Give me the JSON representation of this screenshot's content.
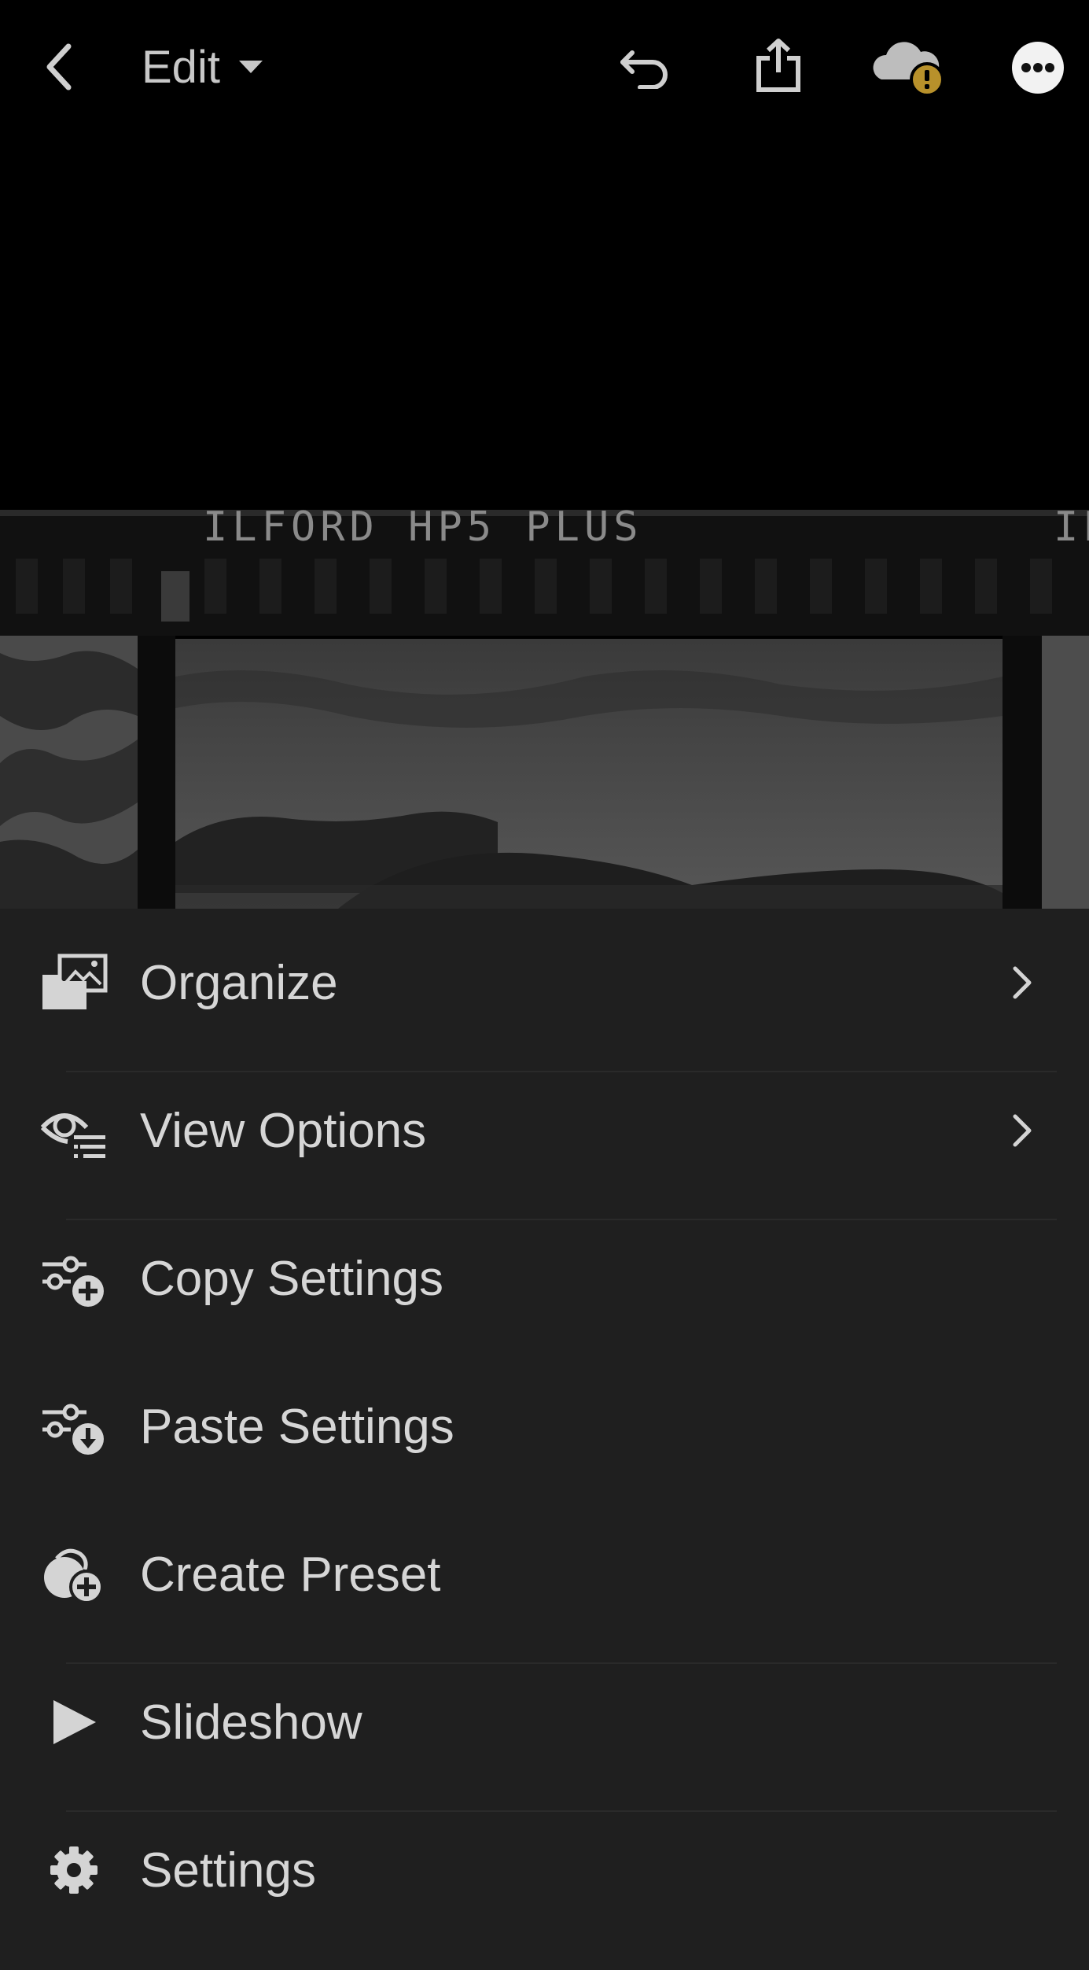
{
  "header": {
    "mode_label": "Edit",
    "icons": [
      "back-arrow-icon",
      "caret-down-icon",
      "undo-icon",
      "share-icon",
      "cloud-warning-icon",
      "more-icon"
    ]
  },
  "photo": {
    "film_text": "ILFORD HP5 PLUS",
    "film_text_partial": "IL"
  },
  "menu": {
    "items": [
      {
        "label": "Organize",
        "icon": "organize-icon",
        "has_submenu": true
      },
      {
        "label": "View Options",
        "icon": "view-options-icon",
        "has_submenu": true
      },
      {
        "label": "Copy Settings",
        "icon": "copy-settings-icon",
        "has_submenu": false
      },
      {
        "label": "Paste Settings",
        "icon": "paste-settings-icon",
        "has_submenu": false
      },
      {
        "label": "Create Preset",
        "icon": "create-preset-icon",
        "has_submenu": false
      },
      {
        "label": "Slideshow",
        "icon": "play-icon",
        "has_submenu": false
      },
      {
        "label": "Settings",
        "icon": "gear-icon",
        "has_submenu": false
      }
    ]
  },
  "colors": {
    "background": "#000000",
    "menu_background": "#1f1f1f",
    "text": "#d6d6d6",
    "warning_badge": "#b8912b"
  }
}
